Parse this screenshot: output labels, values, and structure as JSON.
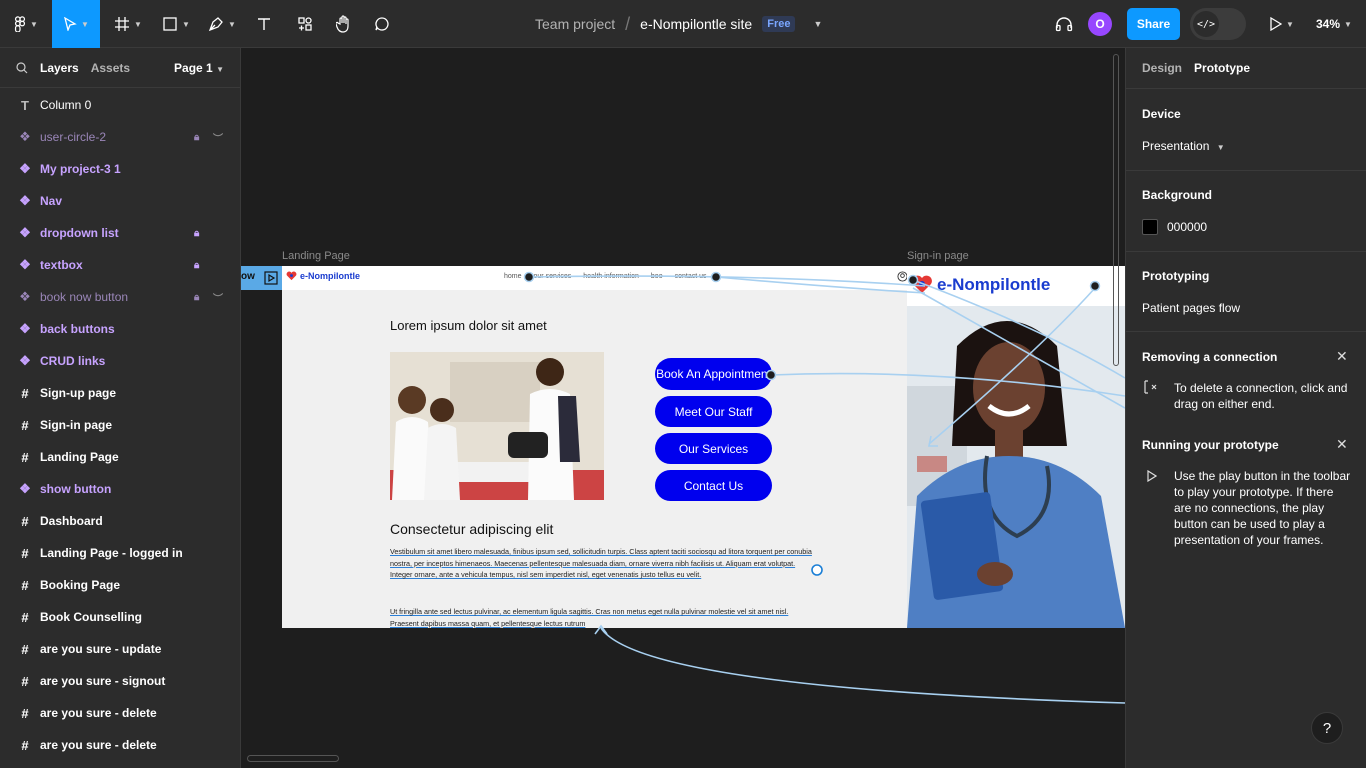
{
  "topbar": {
    "breadcrumb_team": "Team project",
    "breadcrumb_sep": "/",
    "file_name": "e-Nompilontle site",
    "plan_badge": "Free",
    "avatar_initial": "O",
    "share_label": "Share",
    "dev_mode_glyph": "</>",
    "zoom": "34%"
  },
  "layers_panel": {
    "tab_layers": "Layers",
    "tab_assets": "Assets",
    "page_selector": "Page 1",
    "items": [
      {
        "name": "Column 0",
        "kind": "text",
        "icon": "text-icon"
      },
      {
        "name": "user-circle-2",
        "kind": "component-hidden",
        "icon": "component-icon",
        "locked": true,
        "hidden": true
      },
      {
        "name": "My project-3 1",
        "kind": "component",
        "icon": "component-icon"
      },
      {
        "name": "Nav",
        "kind": "component",
        "icon": "component-icon"
      },
      {
        "name": "dropdown list",
        "kind": "component",
        "icon": "component-icon",
        "locked": true
      },
      {
        "name": "textbox",
        "kind": "component",
        "icon": "component-icon",
        "locked": true
      },
      {
        "name": "book now button",
        "kind": "component-hidden",
        "icon": "component-icon",
        "locked": true,
        "hidden": true
      },
      {
        "name": "back buttons",
        "kind": "component",
        "icon": "component-icon"
      },
      {
        "name": "CRUD links",
        "kind": "component",
        "icon": "component-icon"
      },
      {
        "name": "Sign-up page",
        "kind": "frame",
        "icon": "frame-icon"
      },
      {
        "name": "Sign-in page",
        "kind": "frame",
        "icon": "frame-icon"
      },
      {
        "name": "Landing Page",
        "kind": "frame",
        "icon": "frame-icon"
      },
      {
        "name": "show button",
        "kind": "component",
        "icon": "component-icon"
      },
      {
        "name": "Dashboard",
        "kind": "frame",
        "icon": "frame-icon"
      },
      {
        "name": "Landing Page - logged in",
        "kind": "frame",
        "icon": "frame-icon"
      },
      {
        "name": "Booking Page",
        "kind": "frame",
        "icon": "frame-icon"
      },
      {
        "name": "Book Counselling",
        "kind": "frame",
        "icon": "frame-icon"
      },
      {
        "name": "are you sure - update",
        "kind": "frame",
        "icon": "frame-icon"
      },
      {
        "name": "are you sure - signout",
        "kind": "frame",
        "icon": "frame-icon"
      },
      {
        "name": "are you sure - delete",
        "kind": "frame",
        "icon": "frame-icon"
      },
      {
        "name": "are you sure - delete",
        "kind": "frame",
        "icon": "frame-icon"
      }
    ]
  },
  "canvas": {
    "partial_frame_label": "ow",
    "landing_label": "Landing Page",
    "signin_label": "Sign-in page",
    "landing": {
      "logo_text": "e-Nompilontle",
      "nav_links": [
        "home",
        "our services",
        "health information",
        "boo",
        "contact us"
      ],
      "heading1": "Lorem ipsum dolor sit amet",
      "buttons": [
        "Book An Appointment",
        "Meet Our Staff",
        "Our Services",
        "Contact Us"
      ],
      "heading2": "Consectetur adipiscing elit",
      "paragraph1": "Vestibulum sit amet libero malesuada, finibus ipsum sed, sollicitudin turpis. Class aptent taciti sociosqu ad litora torquent per conubia nostra, per inceptos himenaeos. Maecenas pellentesque malesuada diam, ornare viverra nibh facilisis ut. Aliquam erat volutpat. Integer ornare, ante a vehicula tempus, nisl sem imperdiet nisl, eget venenatis justo tellus eu velit.",
      "paragraph2": "Ut fringilla ante sed lectus pulvinar, ac elementum ligula sagittis. Cras non metus eget nulla pulvinar molestie vel sit amet nisl. Praesent dapibus massa quam, et pellentesque lectus rutrum"
    },
    "signin": {
      "logo_text": "e-Nompilontle"
    }
  },
  "right_panel": {
    "tab_design": "Design",
    "tab_prototype": "Prototype",
    "device_title": "Device",
    "device_value": "Presentation",
    "background_title": "Background",
    "background_value": "000000",
    "prototyping_title": "Prototyping",
    "flow_name": "Patient pages flow",
    "tip1_title": "Removing a connection",
    "tip1_body": "To delete a connection, click and drag on either end.",
    "tip2_title": "Running your prototype",
    "tip2_body": "Use the play button in the toolbar to play your prototype. If there are no connections, the play button can be used to play a presentation of your frames.",
    "help_label": "?"
  },
  "colors": {
    "accent": "#0d99ff",
    "component": "#c7a3ff",
    "button_blue": "#0000ee",
    "brand_blue": "#1a3ccf",
    "connection": "#a8d0f0"
  }
}
